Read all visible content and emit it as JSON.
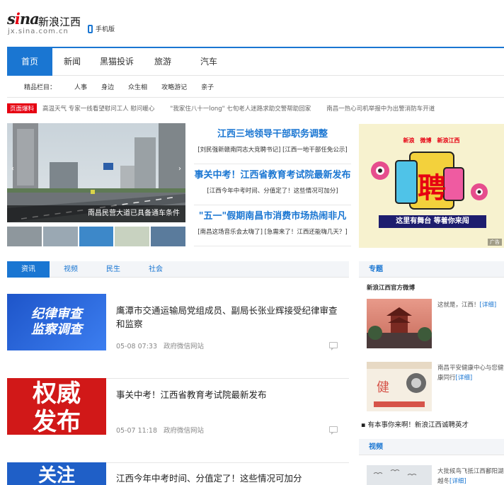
{
  "brand": {
    "wordmark": "sina",
    "site_name": "新浪江西",
    "domain": "jx.sina.com.cn",
    "mobile_label": "手机版"
  },
  "nav": {
    "items": [
      "首页",
      "新闻",
      "黑猫投诉",
      "旅游",
      "汽车"
    ],
    "active_index": 0
  },
  "subnav": {
    "label": "精品栏目：",
    "items": [
      "人事",
      "身边",
      "众生相",
      "攻略游记",
      "亲子"
    ]
  },
  "ticker": {
    "tag": "页面爆料",
    "items": [
      "高温天气  专家一线看望慰问工人 慰问暖心",
      "\"我家住八十一long\"  七旬老人迷路求助交警帮助回家",
      "南昌一热心司机举报中为出警消防车开道"
    ]
  },
  "slideshow": {
    "caption": "南昌民营大道已具备通车条件",
    "prev": "‹",
    "next": "›"
  },
  "headlines": [
    {
      "title": "江西三地领导干部职务调整",
      "sub": "[刘民强新赣南同志大竞聘书记] [江西一地干部任免公示]"
    },
    {
      "title": "事关中考！江西省教育考试院最新发布",
      "sub": "[江西今年中考时间、分值定了！这些情况可加分]"
    },
    {
      "title": "\"五一\"假期南昌市消费市场热闹非凡",
      "sub": "[南昌这场音乐会太嗨了] [急需来了！江西还能嗨几天？]"
    }
  ],
  "ad": {
    "logos": [
      "新浪",
      "微博",
      "新浪江西"
    ],
    "headline": "聘",
    "slogan": "这里有舞台  等着你来闯",
    "badge": "广告"
  },
  "content_tabs": {
    "items": [
      "资讯",
      "视频",
      "民生",
      "社会"
    ],
    "active_index": 0
  },
  "feed": [
    {
      "title": "鹰潭市交通运输局党组成员、副局长张业辉接受纪律审查和监察",
      "date": "05-08 07:33",
      "source": "政府微信网站",
      "image_text": "纪律审查\n监察调查"
    },
    {
      "title": "事关中考！江西省教育考试院最新发布",
      "date": "05-07 11:18",
      "source": "政府微信网站",
      "image_text": "权威\n发布"
    },
    {
      "title": "江西今年中考时间、分值定了！这些情况可加分",
      "date": "",
      "source": "",
      "image_text": "关注"
    }
  ],
  "sidebar": {
    "topics_header": "专题",
    "official_weibo": "新浪江西官方微博",
    "items": [
      {
        "text": "这就是，江西！",
        "more": "[详细]"
      },
      {
        "text": "南昌平安健康中心与您健康同行",
        "more": "[详细]"
      }
    ],
    "recruit_line": "▪ 有本事你来啊！新浪江西诚聘英才",
    "video_header": "视频",
    "video_item": {
      "text": "大批候鸟飞抵江西鄱阳湖越冬",
      "more": "[详细]"
    }
  },
  "colors": {
    "brand_blue": "#1a76d2",
    "brand_red": "#e60012"
  }
}
